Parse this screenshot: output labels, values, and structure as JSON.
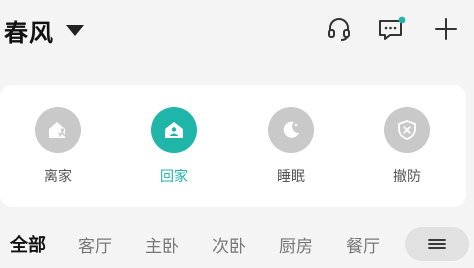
{
  "header": {
    "home_name": "春风",
    "icons": {
      "support": "headset-icon",
      "messages": "message-icon",
      "add": "plus-icon"
    },
    "message_badge_color": "#1fb5a9"
  },
  "modes": [
    {
      "label": "离家",
      "icon": "away-home-icon",
      "active": false
    },
    {
      "label": "回家",
      "icon": "home-icon",
      "active": true
    },
    {
      "label": "睡眠",
      "icon": "moon-icon",
      "active": false
    },
    {
      "label": "撤防",
      "icon": "disarm-shield-icon",
      "active": false
    }
  ],
  "rooms": {
    "tabs": [
      "全部",
      "客厅",
      "主卧",
      "次卧",
      "厨房",
      "餐厅"
    ],
    "active_tab": "全部",
    "more_icon": "menu-icon"
  },
  "colors": {
    "accent": "#1fb5a9",
    "inactive_icon_bg": "#c9c9c9",
    "card_bg": "#ffffff",
    "page_bg": "#f4f4f4"
  }
}
